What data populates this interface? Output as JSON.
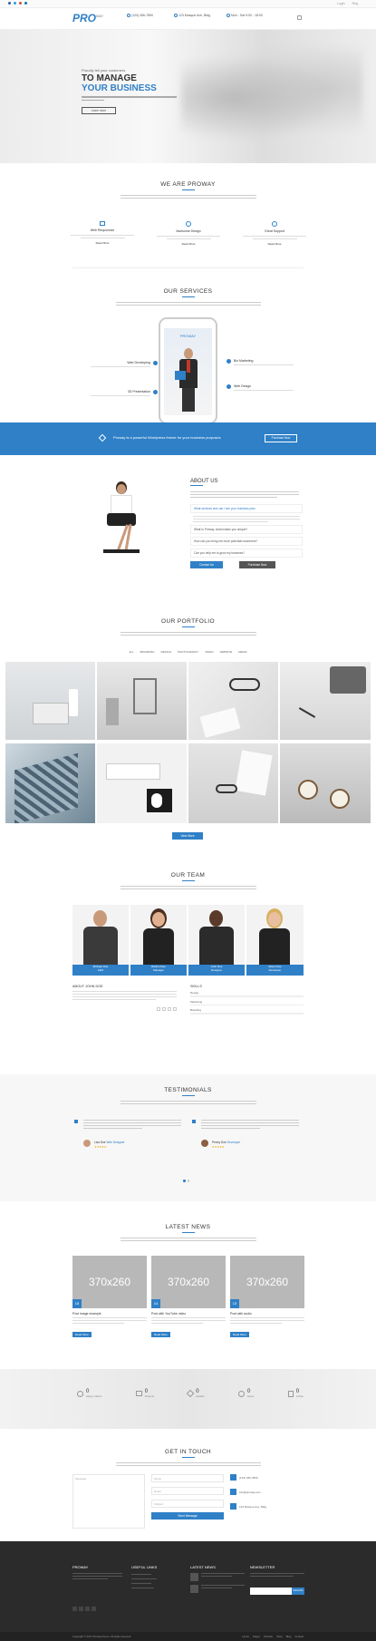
{
  "brand": {
    "name": "PRO",
    "suffix": "WAY",
    "color": "#2f80c7"
  },
  "topbar": {
    "contact1": "",
    "login": "Login",
    "register": "Reg"
  },
  "header": {
    "phone": "(123) 456-7890",
    "phone_sub": "",
    "address": "123 Mosque Ave, Bldg",
    "address_sub": "",
    "hours": "Mon - Sat 9:00 - 18:00",
    "hours_sub": ""
  },
  "hero": {
    "pre": "Proudly tell your customers",
    "line1": "TO MANAGE",
    "line2": "YOUR BUSINESS",
    "text": "",
    "button": "Learn more"
  },
  "we_are": {
    "title": "WE ARE PROWAY",
    "text": "",
    "features": [
      {
        "icon": "monitor-icon",
        "title": "Web Responsive",
        "text": "",
        "link": "Read More"
      },
      {
        "icon": "gear-icon",
        "title": "Awesome Design",
        "text": "",
        "link": "Read More"
      },
      {
        "icon": "support-icon",
        "title": "Great Support",
        "text": "",
        "link": "Read More"
      }
    ]
  },
  "services": {
    "title": "OUR SERVICES",
    "phone_label": "PROWAY",
    "items_left": [
      {
        "title": "Web Developing",
        "text": ""
      },
      {
        "title": "3D Presentation",
        "text": ""
      }
    ],
    "items_right": [
      {
        "title": "Bio Marketing",
        "text": ""
      },
      {
        "title": "Web Design",
        "text": ""
      }
    ]
  },
  "banner": {
    "text": "Proway is a powerful Wordpress theme for your business purposes",
    "button": "Purchase Now"
  },
  "about": {
    "title": "ABOUT US",
    "items": [
      "What services and can I see your business plan",
      "What Is Proway, what makes you unique?",
      "How can you bring me more potential customers?",
      "Can you help me to grow my business?"
    ],
    "btn1": "Contact Us",
    "btn2": "Purchase Now"
  },
  "portfolio": {
    "title": "OUR PORTFOLIO",
    "filters": [
      "ALL",
      "BRANDING",
      "DESIGN",
      "PHOTOGRAPHY",
      "VIDEO",
      "WEBSITE",
      "MEDIA"
    ],
    "button": "View More"
  },
  "team": {
    "title": "OUR TEAM",
    "members": [
      {
        "name": "Michael Doe",
        "role": "CEO"
      },
      {
        "name": "Rachel Doe",
        "role": "Manager"
      },
      {
        "name": "John Doe",
        "role": "Designer"
      },
      {
        "name": "Alison Doe",
        "role": "Developer"
      }
    ],
    "about_title": "ABOUT JOHN DOE",
    "skills_title": "SKILLS",
    "skills": [
      "Design",
      "Marketing",
      "Branding"
    ]
  },
  "testimonials": {
    "title": "TESTIMONIALS",
    "items": [
      {
        "name": "Lisa Doe",
        "role": "Web Designer"
      },
      {
        "name": "Penny Doe",
        "role": "Developer"
      }
    ]
  },
  "news": {
    "title": "LATEST NEWS",
    "posts": [
      {
        "date": "15",
        "img": "370x260",
        "title": "Post image example",
        "meta": "",
        "link": "Read More"
      },
      {
        "date": "14",
        "img": "370x260",
        "title": "Post with YouTube video",
        "meta": "",
        "link": "Read More"
      },
      {
        "date": "13",
        "img": "370x260",
        "title": "Post with audio",
        "meta": "",
        "link": "Read More"
      }
    ]
  },
  "counters": [
    {
      "icon": "user-icon",
      "value": "0",
      "label": "Happy Clients"
    },
    {
      "icon": "briefcase-icon",
      "value": "0",
      "label": "Projects"
    },
    {
      "icon": "diamond-icon",
      "value": "0",
      "label": "Awards"
    },
    {
      "icon": "clock-icon",
      "value": "0",
      "label": "Hours"
    },
    {
      "icon": "coffee-icon",
      "value": "0",
      "label": "Coffee"
    }
  ],
  "contact": {
    "title": "GET IN TOUCH",
    "textarea": "Message",
    "fields": [
      "Name",
      "Email",
      "Subject"
    ],
    "button": "Send Message",
    "info": [
      "(123) 456-7890",
      "info@proway.com",
      "123 Mosque Ave, Bldg"
    ]
  },
  "footer": {
    "col1": "PROWAY",
    "col2": "USEFUL LINKS",
    "col3": "LATEST NEWS",
    "col4": "NEWSLETTER",
    "copyright": "Copyright © 2017 Proway theme. All rights reserved",
    "menu": [
      "Home",
      "Pages",
      "Portfolio",
      "Shop",
      "Blog",
      "Contact"
    ],
    "subscribe": "Subscribe"
  }
}
